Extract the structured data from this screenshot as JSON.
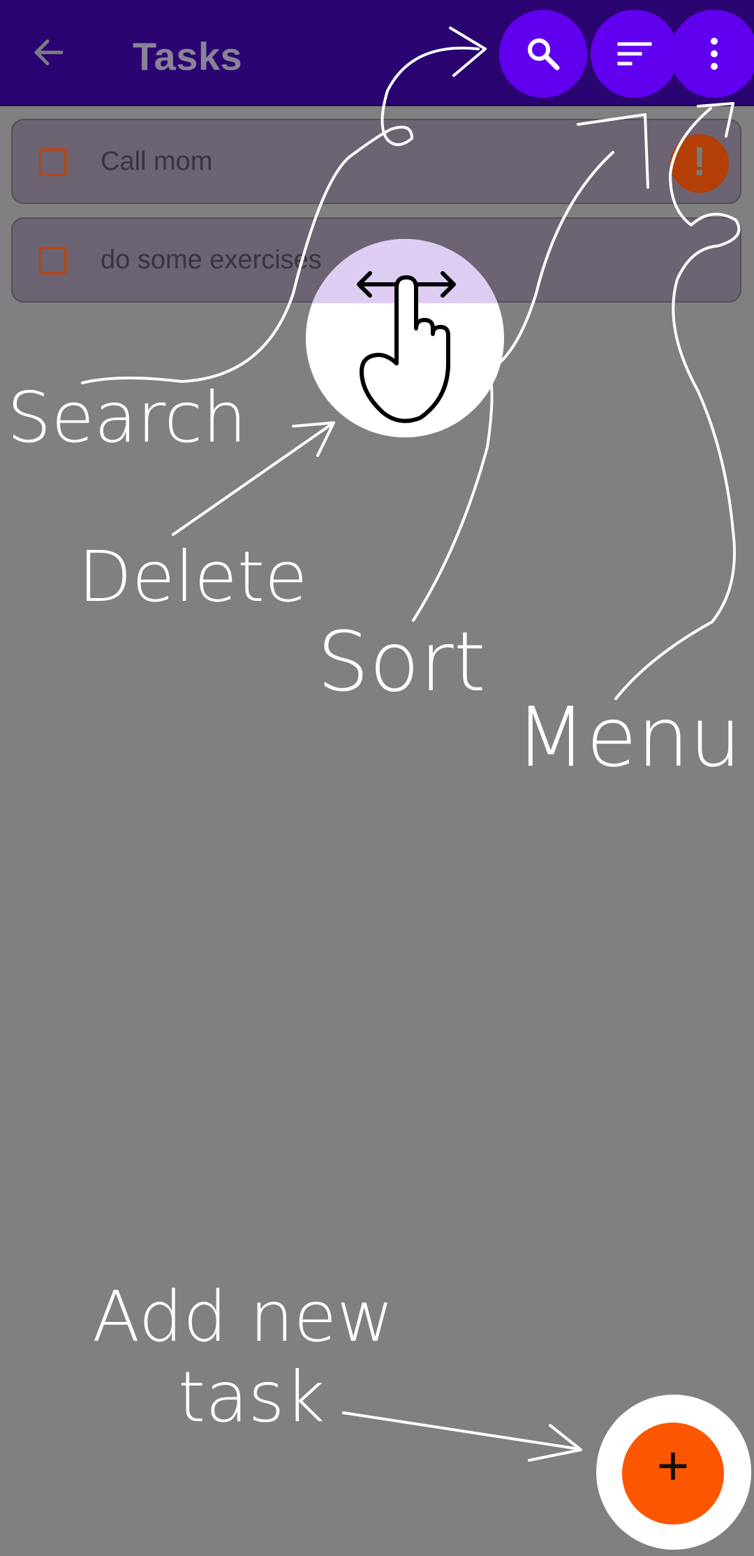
{
  "appbar": {
    "title": "Tasks",
    "back_icon": "arrow-back-icon",
    "actions": [
      {
        "name": "search",
        "icon": "search-icon"
      },
      {
        "name": "sort",
        "icon": "sort-icon"
      },
      {
        "name": "menu",
        "icon": "more-vert-icon"
      }
    ]
  },
  "tasks": [
    {
      "label": "Call mom",
      "checked": false,
      "priority_icon": "exclamation-icon",
      "priority_glyph": "!"
    },
    {
      "label": "do some exercises",
      "checked": false
    }
  ],
  "tutorial": {
    "search": "Search",
    "delete": "Delete",
    "sort": "Sort",
    "menu": "Menu",
    "add_line1": "Add new",
    "add_line2": "task",
    "swipe_hint_icon": "swipe-hand-icon"
  },
  "fab": {
    "icon": "plus-icon",
    "glyph": "+"
  },
  "colors": {
    "appbar": "#2a0571",
    "accent": "#6100ee",
    "fab": "#fd5600",
    "dim": "#808080"
  }
}
